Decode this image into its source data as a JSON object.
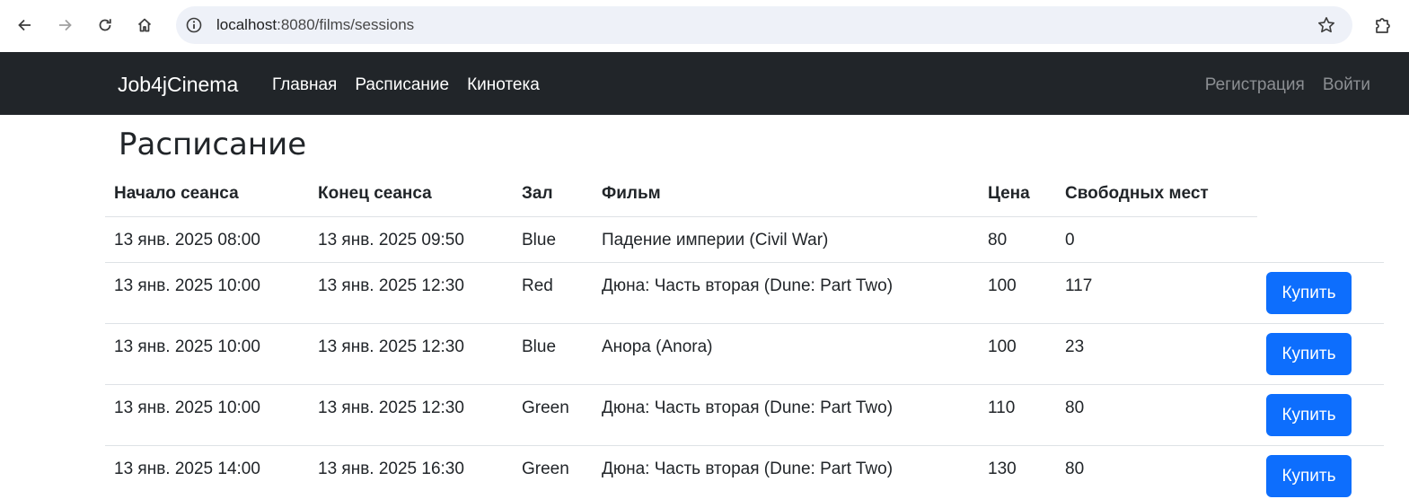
{
  "browser": {
    "url_host": "localhost",
    "url_rest": ":8080/films/sessions"
  },
  "navbar": {
    "brand": "Job4jCinema",
    "links": [
      "Главная",
      "Расписание",
      "Кинотека"
    ],
    "right_links": [
      "Регистрация",
      "Войти"
    ],
    "background": "#212529"
  },
  "main": {
    "title": "Расписание",
    "table": {
      "headers": [
        "Начало сеанса",
        "Конец сеанса",
        "Зал",
        "Фильм",
        "Цена",
        "Свободных мест"
      ],
      "rows": [
        {
          "start": "13 янв. 2025 08:00",
          "end": "13 янв. 2025 09:50",
          "hall": "Blue",
          "film": "Падение империи (Civil War)",
          "price": "80",
          "free": "0",
          "buy": ""
        },
        {
          "start": "13 янв. 2025 10:00",
          "end": "13 янв. 2025 12:30",
          "hall": "Red",
          "film": "Дюна: Часть вторая (Dune: Part Two)",
          "price": "100",
          "free": "117",
          "buy": "Купить"
        },
        {
          "start": "13 янв. 2025 10:00",
          "end": "13 янв. 2025 12:30",
          "hall": "Blue",
          "film": "Анора (Anora)",
          "price": "100",
          "free": "23",
          "buy": "Купить"
        },
        {
          "start": "13 янв. 2025 10:00",
          "end": "13 янв. 2025 12:30",
          "hall": "Green",
          "film": "Дюна: Часть вторая (Dune: Part Two)",
          "price": "110",
          "free": "80",
          "buy": "Купить"
        },
        {
          "start": "13 янв. 2025 14:00",
          "end": "13 янв. 2025 16:30",
          "hall": "Green",
          "film": "Дюна: Часть вторая (Dune: Part Two)",
          "price": "130",
          "free": "80",
          "buy": "Купить"
        }
      ]
    },
    "button_color": "#0d6efd"
  }
}
